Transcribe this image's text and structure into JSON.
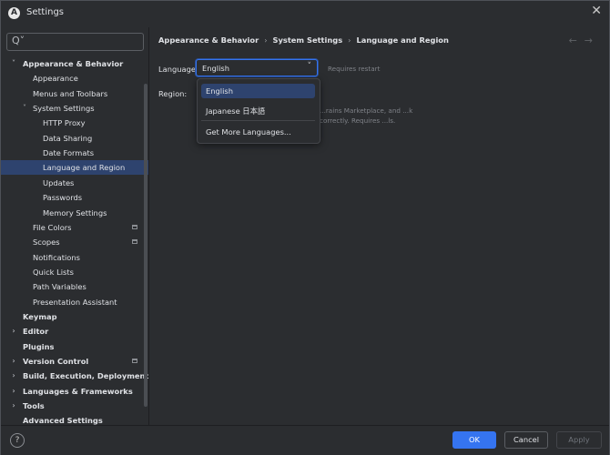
{
  "window": {
    "title": "Settings",
    "close_glyph": "✕",
    "logo_glyph": "A"
  },
  "search": {
    "glyph": "Q˅",
    "placeholder": ""
  },
  "tree": [
    {
      "label": "Appearance & Behavior",
      "level": 0,
      "expanded": true,
      "bold": true,
      "arrow": "˅"
    },
    {
      "label": "Appearance",
      "level": 1
    },
    {
      "label": "Menus and Toolbars",
      "level": 1
    },
    {
      "label": "System Settings",
      "level": 1,
      "expanded": true,
      "arrow": "˅"
    },
    {
      "label": "HTTP Proxy",
      "level": 2
    },
    {
      "label": "Data Sharing",
      "level": 2
    },
    {
      "label": "Date Formats",
      "level": 2
    },
    {
      "label": "Language and Region",
      "level": 2,
      "selected": true
    },
    {
      "label": "Updates",
      "level": 2
    },
    {
      "label": "Passwords",
      "level": 2
    },
    {
      "label": "Memory Settings",
      "level": 2
    },
    {
      "label": "File Colors",
      "level": 1,
      "badge": true
    },
    {
      "label": "Scopes",
      "level": 1,
      "badge": true
    },
    {
      "label": "Notifications",
      "level": 1
    },
    {
      "label": "Quick Lists",
      "level": 1
    },
    {
      "label": "Path Variables",
      "level": 1
    },
    {
      "label": "Presentation Assistant",
      "level": 1
    },
    {
      "label": "Keymap",
      "level": 0,
      "bold": true
    },
    {
      "label": "Editor",
      "level": 0,
      "bold": true,
      "arrow": "›"
    },
    {
      "label": "Plugins",
      "level": 0,
      "bold": true
    },
    {
      "label": "Version Control",
      "level": 0,
      "bold": true,
      "arrow": "›",
      "badge": true
    },
    {
      "label": "Build, Execution, Deployment",
      "level": 0,
      "bold": true,
      "arrow": "›"
    },
    {
      "label": "Languages & Frameworks",
      "level": 0,
      "bold": true,
      "arrow": "›"
    },
    {
      "label": "Tools",
      "level": 0,
      "bold": true,
      "arrow": "›"
    },
    {
      "label": "Advanced Settings",
      "level": 0,
      "bold": true
    }
  ],
  "breadcrumb": {
    "items": [
      "Appearance & Behavior",
      "System Settings",
      "Language and Region"
    ],
    "separator": "›"
  },
  "nav": {
    "back": "←",
    "forward": "→"
  },
  "language": {
    "label": "Language:",
    "value": "English",
    "chevron": "˅",
    "note": "Requires restart"
  },
  "region": {
    "label": "Region:",
    "help": "...rains Marketplace, and ...k correctly. Requires ...ls."
  },
  "dropdown": {
    "options": [
      "English",
      "Japanese 日本語"
    ],
    "more": "Get More Languages...",
    "selected": 0
  },
  "footer": {
    "help": "?",
    "ok": "OK",
    "cancel": "Cancel",
    "apply": "Apply"
  },
  "colors": {
    "accent": "#3574f0",
    "selection": "#2e436e",
    "background": "#2b2d30"
  }
}
